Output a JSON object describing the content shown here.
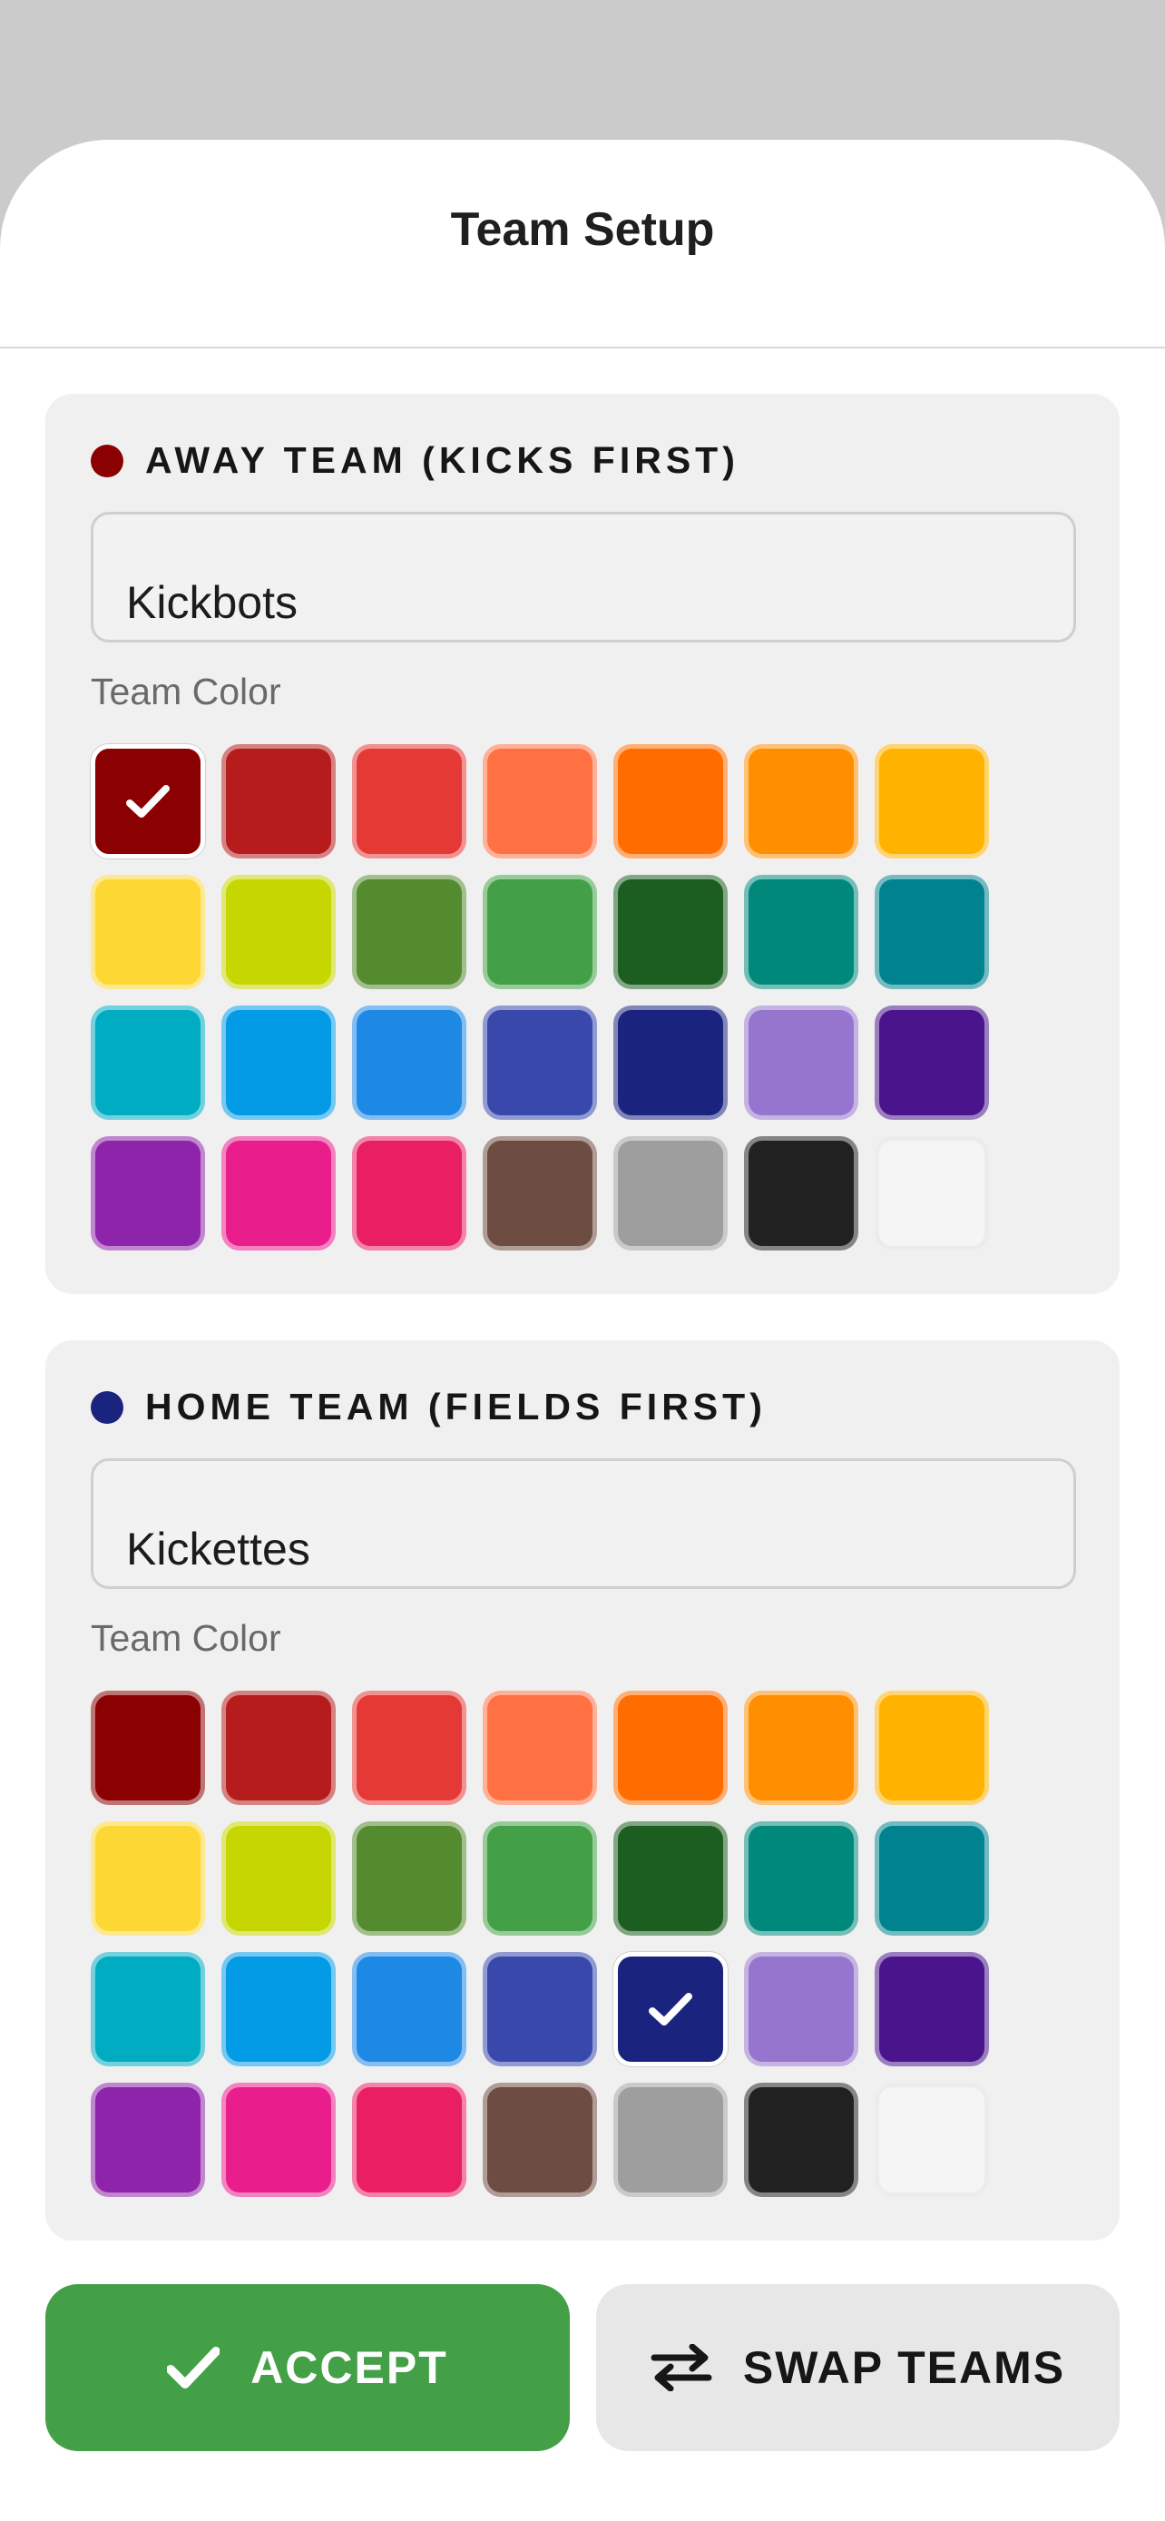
{
  "header": {
    "title": "Team Setup"
  },
  "palette": [
    "#8b0000",
    "#b71c1c",
    "#e53935",
    "#ff7043",
    "#ff6d00",
    "#ff8f00",
    "#ffb300",
    "#fdd835",
    "#c6d600",
    "#558b2f",
    "#43a047",
    "#1b5e20",
    "#00897b",
    "#00838f",
    "#00acc1",
    "#039be5",
    "#1e88e5",
    "#3949ab",
    "#1a237e",
    "#9575cd",
    "#4a148c",
    "#8e24aa",
    "#e91e8c",
    "#e91e63",
    "#6d4c41",
    "#9e9e9e",
    "#212121",
    "#f5f5f5"
  ],
  "away": {
    "label": "AWAY TEAM (KICKS FIRST)",
    "name_value": "Kickbots",
    "color_label": "Team Color",
    "selected_color_index": 0,
    "dot_color": "#8b0000"
  },
  "home": {
    "label": "HOME TEAM (FIELDS FIRST)",
    "name_value": "Kickettes",
    "color_label": "Team Color",
    "selected_color_index": 18,
    "dot_color": "#1a237e"
  },
  "actions": {
    "accept_label": "ACCEPT",
    "accept_icon": "check-icon",
    "swap_label": "SWAP TEAMS",
    "swap_icon": "swap-arrows-icon",
    "accept_color": "#43a047"
  }
}
